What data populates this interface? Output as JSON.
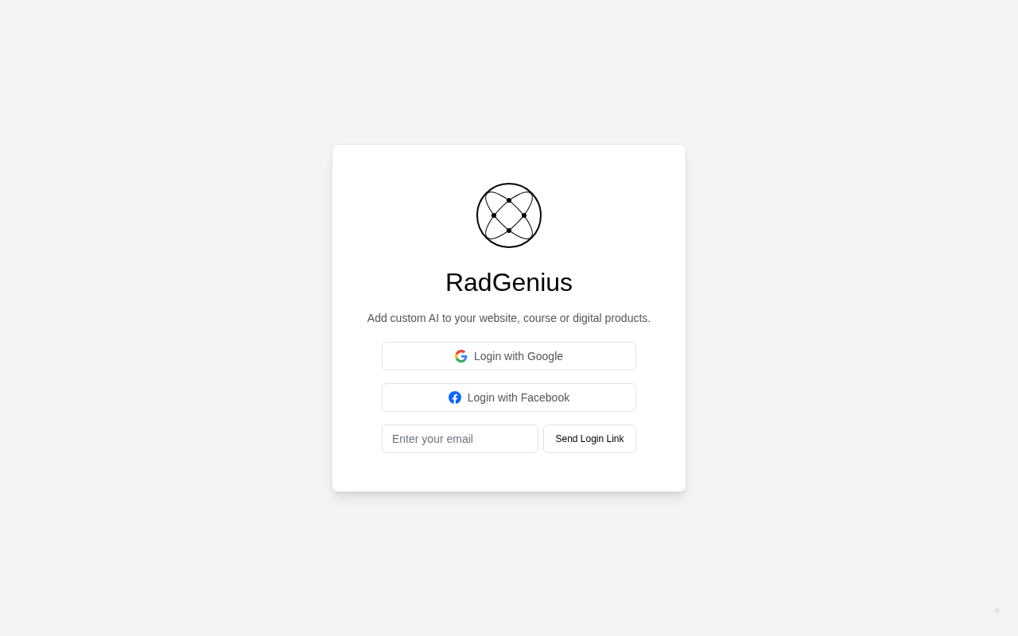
{
  "brand": {
    "name": "RadGenius",
    "tagline": "Add custom AI to your website, course or digital products."
  },
  "buttons": [
    {
      "kind": "google",
      "label": "Login with Google"
    },
    {
      "kind": "facebook",
      "label": "Login with Facebook"
    }
  ],
  "email": {
    "placeholder": "Enter your email",
    "submit": "Send Login Link"
  }
}
